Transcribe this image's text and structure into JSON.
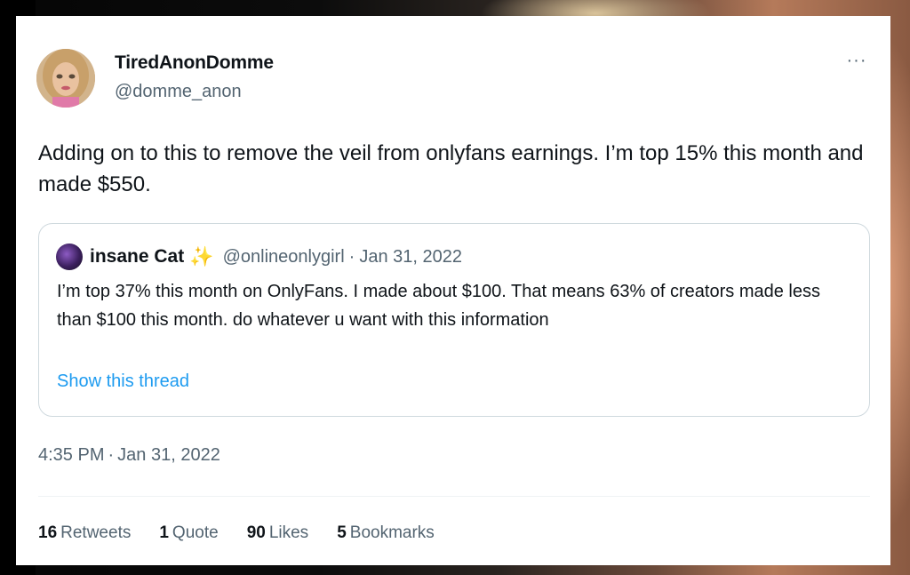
{
  "colors": {
    "text_primary": "#0f1419",
    "text_secondary": "#536471",
    "link": "#1d9bf0",
    "border": "#cfd9de",
    "sparkle": "#f5b731"
  },
  "tweet": {
    "display_name": "TiredAnonDomme",
    "handle": "@domme_anon",
    "more_icon": "more-horizontal-icon",
    "more_label": "···",
    "text": "Adding on to this to remove the veil from onlyfans earnings. I’m top 15% this month and made $550.",
    "timestamp_time": "4:35 PM",
    "timestamp_sep": "·",
    "timestamp_date": "Jan 31, 2022"
  },
  "quote": {
    "display_name": "insane Cat",
    "badge_icon": "sparkles-icon",
    "badge_glyph": "✨",
    "handle": "@onlineonlygirl",
    "sep": "·",
    "date": "Jan 31, 2022",
    "text": "I’m top 37% this month on OnlyFans. I made about $100. That means 63% of creators made less than $100 this month. do whatever u want with this information",
    "show_thread": "Show this thread"
  },
  "stats": [
    {
      "value": "16",
      "label": "Retweets"
    },
    {
      "value": "1",
      "label": "Quote"
    },
    {
      "value": "90",
      "label": "Likes"
    },
    {
      "value": "5",
      "label": "Bookmarks"
    }
  ]
}
